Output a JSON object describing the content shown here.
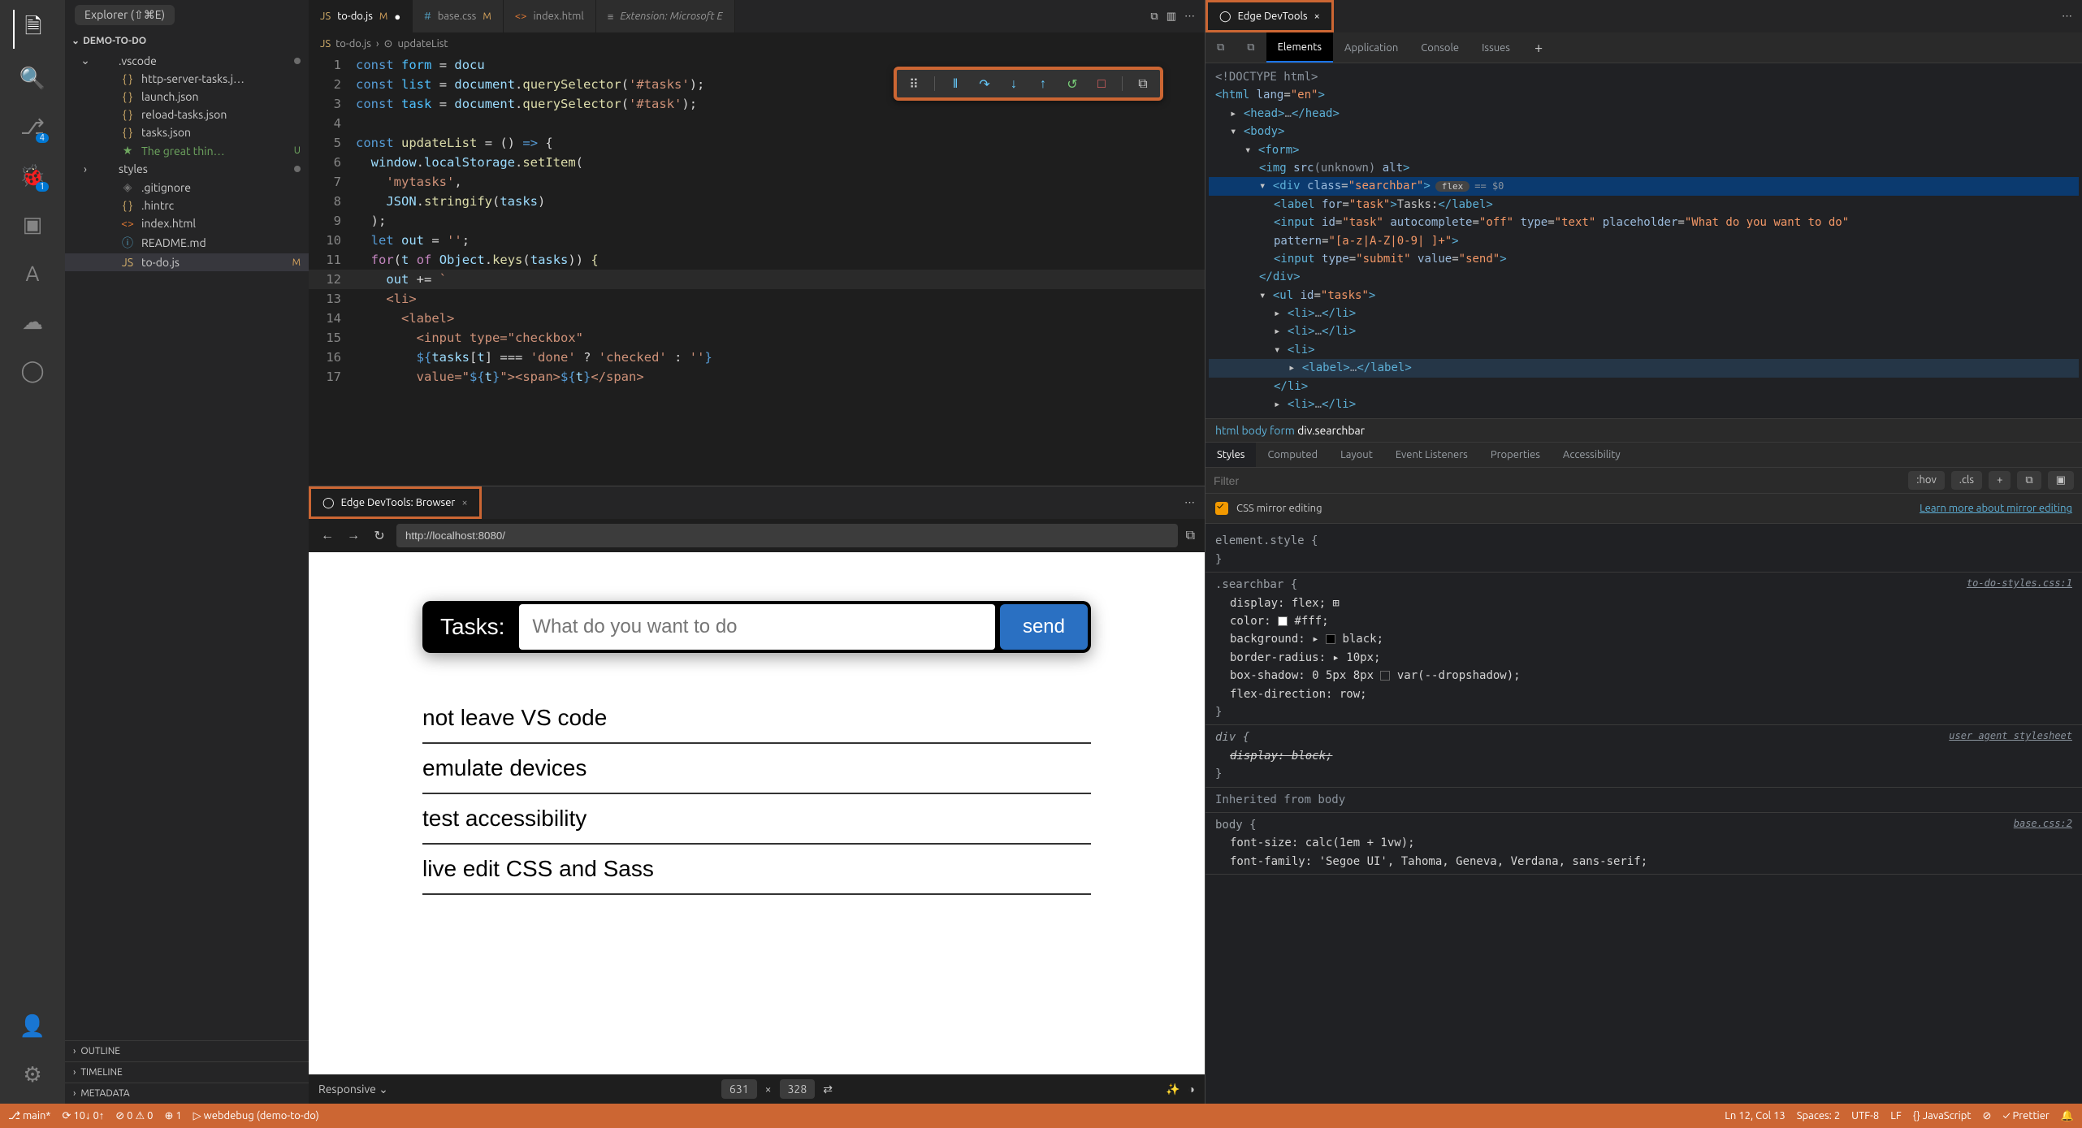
{
  "explorer": {
    "title": "Explorer (⇧⌘E)",
    "project": "DEMO-TO-DO",
    "tree": [
      {
        "chev": "⌄",
        "icon": "",
        "name": ".vscode",
        "cls": "",
        "status": "dot"
      },
      {
        "chev": "",
        "icon": "{ }",
        "name": "http-server-tasks.j…",
        "cls": "ic-yellow"
      },
      {
        "chev": "",
        "icon": "{ }",
        "name": "launch.json",
        "cls": "ic-yellow"
      },
      {
        "chev": "",
        "icon": "{ }",
        "name": "reload-tasks.json",
        "cls": "ic-yellow"
      },
      {
        "chev": "",
        "icon": "{ }",
        "name": "tasks.json",
        "cls": "ic-yellow"
      },
      {
        "chev": "",
        "icon": "★",
        "name": "The great thin…",
        "cls": "ic-green",
        "status": "U"
      },
      {
        "chev": "›",
        "icon": "",
        "name": "styles",
        "cls": "",
        "status": "dot"
      },
      {
        "chev": "",
        "icon": "◈",
        "name": ".gitignore",
        "cls": "ic-gray"
      },
      {
        "chev": "",
        "icon": "{ }",
        "name": ".hintrc",
        "cls": "ic-yellow"
      },
      {
        "chev": "",
        "icon": "<>",
        "name": "index.html",
        "cls": "ic-orange"
      },
      {
        "chev": "",
        "icon": "ⓘ",
        "name": "README.md",
        "cls": "ic-blue"
      },
      {
        "chev": "",
        "icon": "JS",
        "name": "to-do.js",
        "cls": "ic-yellow",
        "status": "M",
        "selected": true
      }
    ],
    "collapsed": [
      "OUTLINE",
      "TIMELINE",
      "METADATA"
    ]
  },
  "editor": {
    "tabs": [
      {
        "icon": "JS",
        "label": "to-do.js",
        "m": "M",
        "active": true,
        "ic": "ic-yellow"
      },
      {
        "icon": "#",
        "label": "base.css",
        "m": "M",
        "ic": "ic-blue"
      },
      {
        "icon": "<>",
        "label": "index.html",
        "ic": "ic-orange"
      },
      {
        "icon": "≡",
        "label": "Extension: Microsoft E",
        "italic": true
      }
    ],
    "breadcrumb": [
      "JS",
      "to-do.js",
      "›",
      "⊙",
      "updateList"
    ],
    "debugButtons": [
      "⠿",
      "‖",
      "↷",
      "↓",
      "↑",
      "↺",
      "□",
      "⧉"
    ],
    "code": [
      {
        "n": 1,
        "html": "<span class='tok-kw2'>const</span> <span class='tok-const'>form</span> <span class='tok-punct'>=</span> <span class='tok-var'>docu</span>"
      },
      {
        "n": 2,
        "html": "<span class='tok-kw2'>const</span> <span class='tok-const'>list</span> <span class='tok-punct'>=</span> <span class='tok-var'>document</span><span class='tok-punct'>.</span><span class='tok-fn'>querySelector</span><span class='tok-punct'>(</span><span class='tok-str'>'#tasks'</span><span class='tok-punct'>);</span>"
      },
      {
        "n": 3,
        "html": "<span class='tok-kw2'>const</span> <span class='tok-const'>task</span> <span class='tok-punct'>=</span> <span class='tok-var'>document</span><span class='tok-punct'>.</span><span class='tok-fn'>querySelector</span><span class='tok-punct'>(</span><span class='tok-str'>'#task'</span><span class='tok-punct'>);</span>"
      },
      {
        "n": 4,
        "html": ""
      },
      {
        "n": 5,
        "html": "<span class='tok-kw2'>const</span> <span class='tok-fn'>updateList</span> <span class='tok-punct'>= () </span><span class='tok-kw2'>=&gt;</span> <span class='tok-punct'>{</span>"
      },
      {
        "n": 6,
        "html": "  <span class='tok-var'>window</span><span class='tok-punct'>.</span><span class='tok-var'>localStorage</span><span class='tok-punct'>.</span><span class='tok-fn'>setItem</span><span class='tok-punct'>(</span>"
      },
      {
        "n": 7,
        "html": "    <span class='tok-str'>'mytasks'</span><span class='tok-punct'>,</span>"
      },
      {
        "n": 8,
        "html": "    <span class='tok-var'>JSON</span><span class='tok-punct'>.</span><span class='tok-fn'>stringify</span><span class='tok-punct'>(</span><span class='tok-var'>tasks</span><span class='tok-punct'>)</span>"
      },
      {
        "n": 9,
        "html": "  <span class='tok-punct'>);</span>"
      },
      {
        "n": 10,
        "html": "  <span class='tok-kw2'>let</span> <span class='tok-var'>out</span> <span class='tok-punct'>=</span> <span class='tok-str'>''</span><span class='tok-punct'>;</span>"
      },
      {
        "n": 11,
        "html": "  <span class='tok-kw'>for</span><span class='tok-punct'>(</span><span class='tok-var'>t</span> <span class='tok-kw'>of</span> <span class='tok-var'>Object</span><span class='tok-punct'>.</span><span class='tok-fn'>keys</span><span class='tok-punct'>(</span><span class='tok-var'>tasks</span><span class='tok-punct'>)) </span><span class='tok-fn'>{</span>"
      },
      {
        "n": 12,
        "html": "    <span class='tok-var'>out</span> <span class='tok-punct'>+=</span> <span class='tok-str'>`</span>",
        "current": true
      },
      {
        "n": 13,
        "html": "    <span class='tok-str'>&lt;li&gt;</span>"
      },
      {
        "n": 14,
        "html": "      <span class='tok-str'>&lt;label&gt;</span>"
      },
      {
        "n": 15,
        "html": "        <span class='tok-str'>&lt;input type=\"checkbox\"</span>"
      },
      {
        "n": 16,
        "html": "        <span class='tok-kw2'>${</span><span class='tok-var'>tasks</span><span class='tok-punct'>[</span><span class='tok-var'>t</span><span class='tok-punct'>]</span> <span class='tok-punct'>===</span> <span class='tok-str'>'done'</span> <span class='tok-punct'>?</span> <span class='tok-str'>'checked'</span> <span class='tok-punct'>:</span> <span class='tok-str'>''</span><span class='tok-kw2'>}</span>"
      },
      {
        "n": 17,
        "html": "        <span class='tok-str'>value=\"</span><span class='tok-kw2'>${</span><span class='tok-var'>t</span><span class='tok-kw2'>}</span><span class='tok-str'>\"&gt;&lt;span&gt;</span><span class='tok-kw2'>${</span><span class='tok-var'>t</span><span class='tok-kw2'>}</span><span class='tok-str'>&lt;/span&gt;</span>"
      }
    ]
  },
  "browser": {
    "tabTitle": "Edge DevTools: Browser",
    "url": "http://localhost:8080/",
    "tasksLabel": "Tasks:",
    "placeholder": "What do you want to do",
    "sendLabel": "send",
    "items": [
      "not leave VS code",
      "emulate devices",
      "test accessibility",
      "live edit CSS and Sass"
    ],
    "responsive": "Responsive",
    "w": "631",
    "h": "328"
  },
  "devtools": {
    "tabTitle": "Edge DevTools",
    "tools": [
      "Elements",
      "Application",
      "Console",
      "Issues"
    ],
    "dom": [
      {
        "pad": 0,
        "html": "<span class='muted'>&lt;!DOCTYPE html&gt;</span>"
      },
      {
        "pad": 0,
        "html": "<span class='tag'>&lt;html</span> <span class='attr'>lang</span>=<span class='val'>\"en\"</span><span class='tag'>&gt;</span>"
      },
      {
        "pad": 1,
        "html": "▸ <span class='tag'>&lt;head&gt;</span><span class='muted'>…</span><span class='tag'>&lt;/head&gt;</span>"
      },
      {
        "pad": 1,
        "html": "▾ <span class='tag'>&lt;body&gt;</span>"
      },
      {
        "pad": 2,
        "html": "▾ <span class='tag'>&lt;form&gt;</span>"
      },
      {
        "pad": 3,
        "html": "<span class='tag'>&lt;img</span> <span class='attr'>src</span><span class='muted'>(unknown)</span> <span class='attr'>alt</span><span class='tag'>&gt;</span>"
      },
      {
        "pad": 3,
        "html": "▾ <span class='tag'>&lt;div</span> <span class='attr'>class</span>=<span class='val'>\"searchbar\"</span><span class='tag'>&gt;</span><span class='pill-flex'>flex</span><span class='pill-eq'>== $0</span>",
        "sel": true
      },
      {
        "pad": 4,
        "html": "<span class='tag'>&lt;label</span> <span class='attr'>for</span>=<span class='val'>\"task\"</span><span class='tag'>&gt;</span>Tasks:<span class='tag'>&lt;/label&gt;</span>"
      },
      {
        "pad": 4,
        "html": "<span class='tag'>&lt;input</span> <span class='attr'>id</span>=<span class='val'>\"task\"</span> <span class='attr'>autocomplete</span>=<span class='val'>\"off\"</span> <span class='attr'>type</span>=<span class='val'>\"text\"</span> <span class='attr'>placeholder</span>=<span class='val'>\"What do you want to do\"</span>"
      },
      {
        "pad": 4,
        "html": "<span class='attr'>pattern</span>=<span class='val'>\"[a-z|A-Z|0-9| ]+\"</span><span class='tag'>&gt;</span>"
      },
      {
        "pad": 4,
        "html": "<span class='tag'>&lt;input</span> <span class='attr'>type</span>=<span class='val'>\"submit\"</span> <span class='attr'>value</span>=<span class='val'>\"send\"</span><span class='tag'>&gt;</span>"
      },
      {
        "pad": 3,
        "html": "<span class='tag'>&lt;/div&gt;</span>"
      },
      {
        "pad": 3,
        "html": "▾ <span class='tag'>&lt;ul</span> <span class='attr'>id</span>=<span class='val'>\"tasks\"</span><span class='tag'>&gt;</span>"
      },
      {
        "pad": 4,
        "html": "▸ <span class='tag'>&lt;li&gt;</span><span class='muted'>…</span><span class='tag'>&lt;/li&gt;</span>"
      },
      {
        "pad": 4,
        "html": "▸ <span class='tag'>&lt;li&gt;</span><span class='muted'>…</span><span class='tag'>&lt;/li&gt;</span>"
      },
      {
        "pad": 4,
        "html": "▾ <span class='tag'>&lt;li&gt;</span>"
      },
      {
        "pad": 5,
        "html": "▸ <span class='tag'>&lt;label&gt;</span><span class='muted'>…</span><span class='tag'>&lt;/label&gt;</span>",
        "sel2": true
      },
      {
        "pad": 4,
        "html": "<span class='tag'>&lt;/li&gt;</span>"
      },
      {
        "pad": 4,
        "html": "▸ <span class='tag'>&lt;li&gt;</span><span class='muted'>…</span><span class='tag'>&lt;/li&gt;</span>"
      }
    ],
    "crumbs": "html   body   form   <span class='cur'>div.searchbar</span>",
    "styleTabs": [
      "Styles",
      "Computed",
      "Layout",
      "Event Listeners",
      "Properties",
      "Accessibility"
    ],
    "filterPlaceholder": "Filter",
    "filterChips": [
      ":hov",
      ".cls",
      "+",
      "⧉",
      "▣"
    ],
    "mirrorLabel": "CSS mirror editing",
    "mirrorLink": "Learn more about mirror editing",
    "rules": [
      {
        "selector": "element.style {",
        "props": [],
        "close": "}"
      },
      {
        "selector": ".searchbar {",
        "src": "to-do-styles.css:1",
        "props": [
          "display: flex; ⊞",
          "color: <span class='swatch white'></span> #fff;",
          "background: ▸ <span class='swatch black'></span> black;",
          "border-radius: ▸ 10px;",
          "box-shadow: 0 5px 8px <span class='swatch'></span> var(--dropshadow);",
          "flex-direction: row;"
        ],
        "close": "}"
      },
      {
        "selector": "div {",
        "src": "user agent stylesheet",
        "ua": true,
        "props": [
          "<span style='text-decoration:line-through'>display: block;</span>"
        ],
        "close": "}"
      },
      {
        "heading": "Inherited from body"
      },
      {
        "selector": "body {",
        "src": "base.css:2",
        "props": [
          "font-size: calc(1em + 1vw);",
          "font-family: 'Segoe UI', Tahoma, Geneva, Verdana, sans-serif;"
        ]
      }
    ]
  },
  "statusBar": {
    "items_left": [
      "⎇ main*",
      "⟳ 10↓ 0↑",
      "⊘ 0 ⚠ 0",
      "⊕ 1",
      "▷ webdebug (demo-to-do)"
    ],
    "items_right": [
      "Ln 12, Col 13",
      "Spaces: 2",
      "UTF-8",
      "LF",
      "{} JavaScript",
      "⊘",
      "✓ Prettier",
      "🔔"
    ]
  }
}
